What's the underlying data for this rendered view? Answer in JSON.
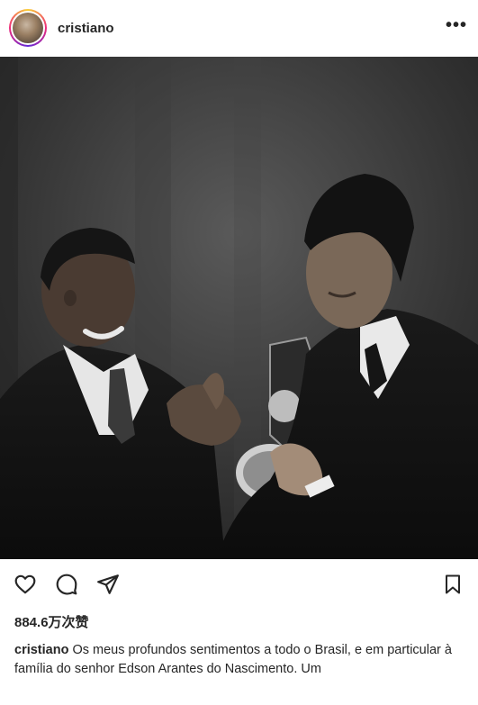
{
  "header": {
    "username": "cristiano",
    "avatar_icon": "avatar-image",
    "more_label": "•••"
  },
  "photo": {
    "description_icon": "photo-black-and-white"
  },
  "actions": {
    "like_icon": "heart-outline-icon",
    "comment_icon": "comment-bubble-icon",
    "share_icon": "paper-plane-icon",
    "save_icon": "bookmark-outline-icon"
  },
  "likes": {
    "text": "884.6万次赞"
  },
  "caption": {
    "username": "cristiano",
    "text": "Os meus profundos sentimentos a todo o Brasil, e em particular à família do senhor Edson Arantes do Nascimento. Um"
  },
  "colors": {
    "text": "#262626",
    "story_ring_start": "#f9ce34",
    "story_ring_mid": "#ee2a7b"
  }
}
